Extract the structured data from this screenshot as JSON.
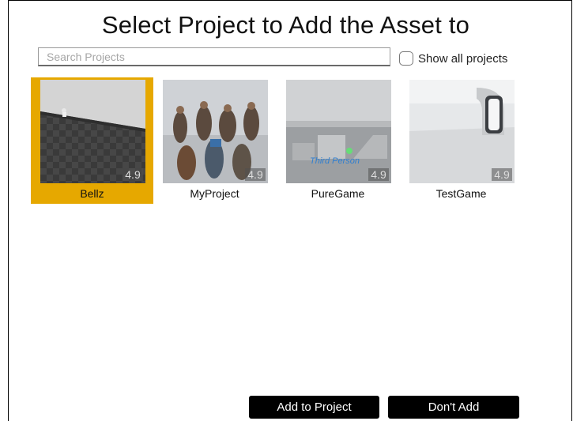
{
  "dialog": {
    "title": "Select Project to Add the Asset to",
    "search": {
      "placeholder": "Search Projects",
      "value": ""
    },
    "show_all": {
      "label": "Show all projects",
      "checked": false
    }
  },
  "projects": [
    {
      "name": "Bellz",
      "version": "4.9",
      "selected": true,
      "thumbnail": "checkered-floor"
    },
    {
      "name": "MyProject",
      "version": "4.9",
      "selected": false,
      "thumbnail": "characters-grid"
    },
    {
      "name": "PureGame",
      "version": "4.9",
      "selected": false,
      "thumbnail": "third-person-template"
    },
    {
      "name": "TestGame",
      "version": "4.9",
      "selected": false,
      "thumbnail": "white-room-window"
    }
  ],
  "buttons": {
    "add": "Add to Project",
    "dont_add": "Don't Add"
  },
  "colors": {
    "selection": "#e6a800",
    "button_bg": "#000000",
    "button_text": "#ffffff"
  }
}
